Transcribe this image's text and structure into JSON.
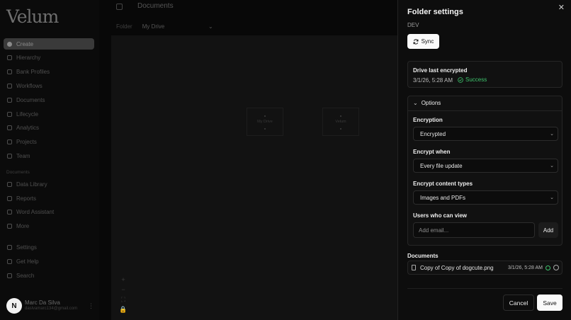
{
  "app": {
    "logo": "Velum"
  },
  "sidebar": {
    "items": [
      {
        "label": "Create",
        "icon": "plus-circle-icon"
      },
      {
        "label": "Hierarchy",
        "icon": "people-icon"
      },
      {
        "label": "Bank Profiles",
        "icon": "bank-icon"
      },
      {
        "label": "Workflows",
        "icon": "workflow-icon"
      },
      {
        "label": "Documents",
        "icon": "document-icon"
      },
      {
        "label": "Lifecycle",
        "icon": "lifecycle-icon"
      },
      {
        "label": "Analytics",
        "icon": "chart-icon"
      },
      {
        "label": "Projects",
        "icon": "folder-icon"
      },
      {
        "label": "Team",
        "icon": "team-icon"
      }
    ],
    "section_label": "Documents",
    "doc_items": [
      {
        "label": "Data Library",
        "icon": "database-icon"
      },
      {
        "label": "Reports",
        "icon": "report-icon"
      },
      {
        "label": "Word Assistant",
        "icon": "assistant-icon"
      },
      {
        "label": "More",
        "icon": "more-icon"
      }
    ],
    "bottom_items": [
      {
        "label": "Settings",
        "icon": "gear-icon"
      },
      {
        "label": "Get Help",
        "icon": "help-icon"
      },
      {
        "label": "Search",
        "icon": "search-icon"
      }
    ],
    "user": {
      "initial": "N",
      "name": "Marc Da Silva",
      "email": "daslvamarc134@gmail.com"
    }
  },
  "main": {
    "title": "Documents",
    "breadcrumb_root": "Folder",
    "drive_select": "My Drive",
    "nodes": [
      "My Drive",
      "Velum"
    ],
    "zoom_controls": [
      "+",
      "−",
      "⛶",
      "🔒"
    ]
  },
  "panel": {
    "title": "Folder settings",
    "folder": "DEV",
    "sync_label": "Sync",
    "last_encrypted": {
      "label": "Drive last encrypted",
      "date": "3/1/26, 5:28 AM",
      "status": "Success"
    },
    "options_label": "Options",
    "encryption": {
      "label": "Encryption",
      "value": "Encrypted"
    },
    "encrypt_when": {
      "label": "Encrypt when",
      "value": "Every file update"
    },
    "content_types": {
      "label": "Encrypt content types",
      "value": "Images and PDFs"
    },
    "users": {
      "label": "Users who can view",
      "placeholder": "Add email...",
      "add_label": "Add"
    },
    "documents_label": "Documents",
    "documents": [
      {
        "name": "Copy of Copy of dogcute.png",
        "date": "3/1/26, 5:28 AM"
      }
    ],
    "cancel_label": "Cancel",
    "save_label": "Save",
    "colors": {
      "success": "#3ec46d",
      "primary_button": "#fafafa"
    }
  }
}
